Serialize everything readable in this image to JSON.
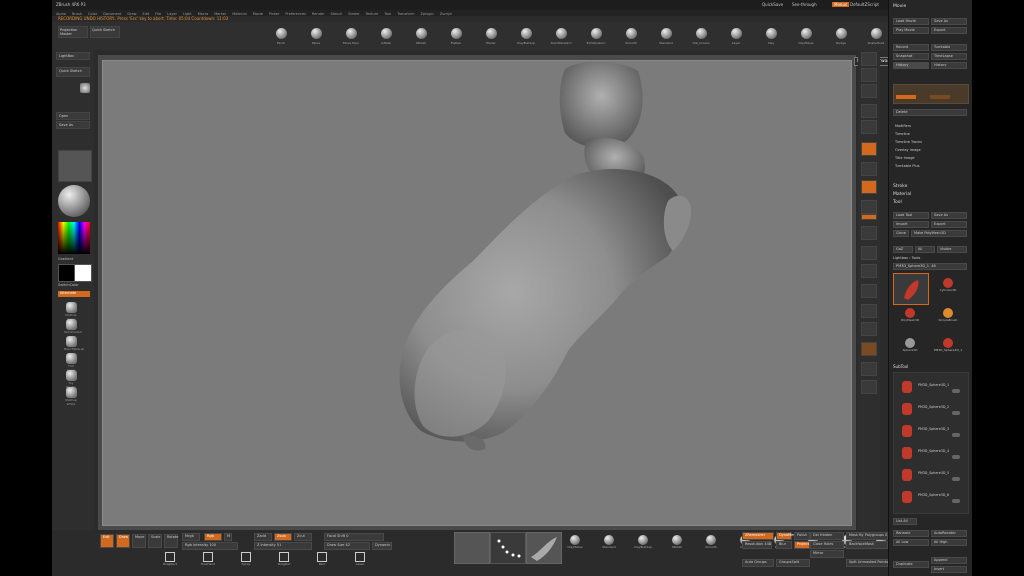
{
  "titlebar": {
    "app_title": "ZBrush 4R6 P3",
    "menus_right": [
      "QuickSave",
      "See-through",
      "Menus",
      "DefaultZScript"
    ]
  },
  "menubar": {
    "items": [
      "Alpha",
      "Brush",
      "Color",
      "Document",
      "Draw",
      "Edit",
      "File",
      "Layer",
      "Light",
      "Macro",
      "Marker",
      "Material",
      "Movie",
      "Picker",
      "Preferences",
      "Render",
      "Stencil",
      "Stroke",
      "Texture",
      "Tool",
      "Transform",
      "Zplugin",
      "Zscript"
    ]
  },
  "recording": {
    "text": "RECORDING UNDO HISTORY.. Press 'Esc' key to abort. Time: 05:04 Countdown: 11:03"
  },
  "top_shelf": {
    "projection_master": "Projection Master",
    "lightbox": "LightBox",
    "quick_sketch": "Quick Sketch",
    "brushes": [
      "Pinch",
      "Move",
      "Move Topo",
      "Inflate",
      "hPolish",
      "Flatten",
      "Planar",
      "ClayBuildup",
      "DamStandard",
      "TrimDynamic",
      "Smooth",
      "Standard",
      "Orb_Cracks",
      "Layer",
      "Clay",
      "ClayTubes",
      "Nudge",
      "SnakeHook"
    ]
  },
  "left_shelf": {
    "lightbox": "LightBox",
    "quick_sketch": "Quick Sketch",
    "open": "Open",
    "save_as": "Save As",
    "gradient": "Gradient",
    "switch_color": "SwitchColor",
    "alternate": "Alternate",
    "materials": [
      "MatCap Gray",
      "SkinShade4",
      "BasicMaterial",
      "Flat Color",
      "Toy Plastic",
      "MatCap White"
    ]
  },
  "tooltip": {
    "text": "Record Forward History"
  },
  "right_tray": {
    "movie": "Movie",
    "load_movie": "Load Movie",
    "save_as": "Save As",
    "play_movie": "Play Movie",
    "export": "Export",
    "record": "Record",
    "turntable": "Turntable",
    "snapshot": "Snapshot",
    "timelapse": "TimeLapse",
    "history": "History",
    "delete": "Delete",
    "modifiers": [
      "Modifiers",
      "Timeline",
      "Timeline Tracks",
      "Overlay Image",
      "Title Image",
      "Turntable Plus"
    ],
    "stroke": "Stroke",
    "material": "Material",
    "tool": "Tool",
    "load_tool": "Load Tool",
    "save_tool": "Save As",
    "import": "Import",
    "tool_export": "Export",
    "clone": "Clone",
    "make_polymesh": "Make PolyMesh3D",
    "goz": "GoZ",
    "all": "All",
    "visible": "Visible",
    "lightbox_tools": "Lightbox › Tools",
    "current_tool": "PM3D_Sphere3D_1. 48",
    "tool_thumbs": [
      "Cylinder3D",
      "PolyMesh3D",
      "SimpleBrush",
      "Sphere3D",
      "PM3D_Sphere3D_1"
    ],
    "subtool": "SubTool",
    "subtools": [
      "PM3D_Sphere3D_1",
      "PM3D_Sphere3D_2",
      "PM3D_Sphere3D_3",
      "PM3D_Sphere3D_4",
      "PM3D_Sphere3D_5",
      "PM3D_Sphere3D_6"
    ],
    "list_all": "List All",
    "rename": "Rename",
    "auto_reorder": "AutoReorder",
    "all_low": "All Low",
    "all_high": "All High",
    "duplicate": "Duplicate",
    "append": "Append",
    "insert": "Insert"
  },
  "bottom_bar": {
    "edit": "Edit",
    "draw": "Draw",
    "move": "Move",
    "scale": "Scale",
    "rotate": "Rotate",
    "mrgb": "Mrgb",
    "rgb": "Rgb",
    "m": "M",
    "zadd": "Zadd",
    "zsub": "Zsub",
    "zcut": "Zcut",
    "rgb_intensity": "Rgb Intensity 100",
    "z_intensity": "Z Intensity 51",
    "focal_shift": "Focal Shift 0",
    "draw_size": "Draw Size 42",
    "dynamic": "Dynamic",
    "brushes": [
      "ClayTubes",
      "Standard",
      "ClayBuildup",
      "hPolish",
      "Smooth",
      "Inflate",
      "Pinch",
      "Move Topo",
      "Snake Hook",
      "Flatten"
    ],
    "strokes": [
      "DragRect",
      "FreeHand",
      "Spray",
      "DragDot",
      "Rect",
      "Lasso"
    ],
    "zremesh": "ZRemesher",
    "dynamesh": "DynaMesh",
    "resolution": "Resolution 448",
    "polish": "Polish",
    "blur": "Blur",
    "project": "Project",
    "auto_groups": "Auto Groups",
    "groups_split": "GroupsSplit",
    "del_hidden": "Del Hidden",
    "close_holes": "Close Holes",
    "mirror": "Mirror",
    "mask_by_polygroups": "Mask By Polygroups 0",
    "backface_mask": "BackfaceMask",
    "split_unmasked": "Split Unmasked Points"
  }
}
